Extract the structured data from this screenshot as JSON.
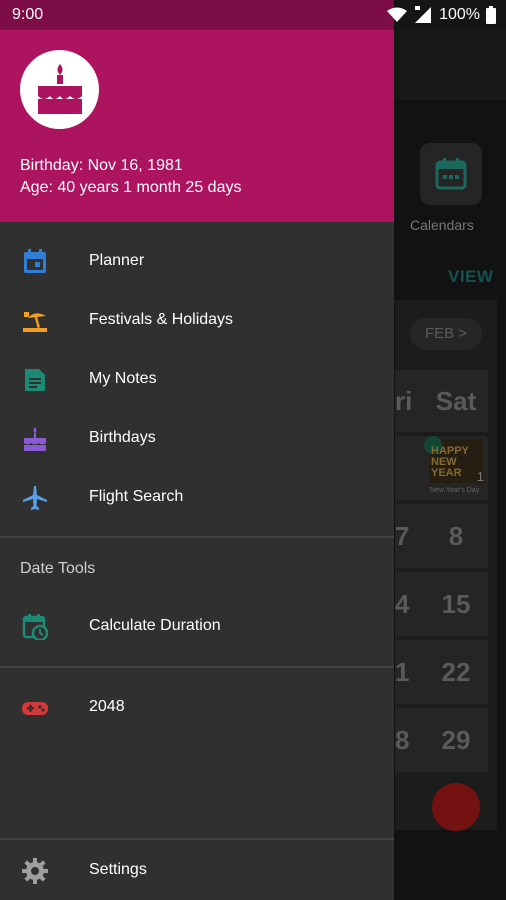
{
  "status_bar": {
    "time": "9:00",
    "battery": "100%",
    "icons": [
      "wifi-icon",
      "signal-icon",
      "battery-icon"
    ]
  },
  "drawer": {
    "header": {
      "birthday": "Birthday: Nov 16, 1981",
      "age": "Age: 40 years 1 month 25 days",
      "avatar_icon": "cake-icon",
      "color": "#ad1460"
    },
    "items": [
      {
        "label": "Planner",
        "icon": "calendar-icon",
        "color": "#2f7fd6"
      },
      {
        "label": "Festivals & Holidays",
        "icon": "beach-umbrella-icon",
        "color": "#f2a01e"
      },
      {
        "label": "My Notes",
        "icon": "note-icon",
        "color": "#1c8a74"
      },
      {
        "label": "Birthdays",
        "icon": "cake-icon",
        "color": "#8a5ad6"
      },
      {
        "label": "Flight Search",
        "icon": "airplane-icon",
        "color": "#5a9ee6"
      }
    ],
    "date_tools": {
      "title": "Date Tools",
      "items": [
        {
          "label": "Calculate Duration",
          "icon": "calendar-clock-icon",
          "color": "#1c8a74"
        }
      ]
    },
    "games": [
      {
        "label": "2048",
        "icon": "gamepad-icon",
        "color": "#d23a3a"
      }
    ],
    "settings": {
      "label": "Settings",
      "icon": "gear-icon",
      "color": "#9e9e9e"
    }
  },
  "background_app": {
    "calendars_label": "Calendars",
    "view_label": "VIEW",
    "month_nav": "FEB >",
    "day_headers": [
      "ri",
      "Sat"
    ],
    "new_year": {
      "text": "HAPPY NEW YEAR",
      "caption": "New Year's Day",
      "number": "1"
    },
    "dates": [
      "8",
      "15",
      "22",
      "29"
    ],
    "partial_dates": [
      "7",
      "4",
      "1",
      "8"
    ]
  }
}
